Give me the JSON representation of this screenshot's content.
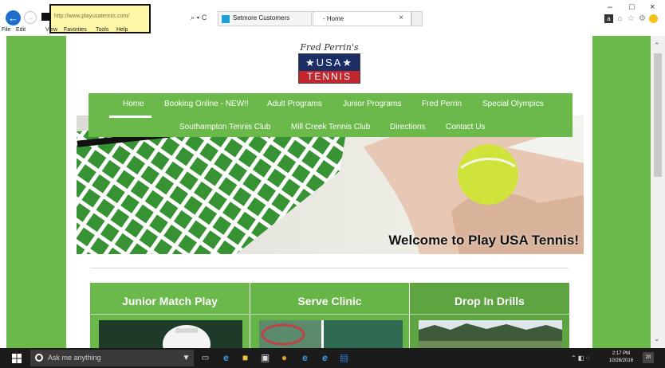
{
  "browser": {
    "address_url": "http://www.playusatennis.com/",
    "addr_controls": "⌕ ▾ C",
    "tabs": [
      {
        "label": "Setmore Customers"
      },
      {
        "label": "- Home",
        "close": "×"
      }
    ],
    "menu": [
      "File",
      "Edit",
      "View",
      "Favorites",
      "Tools",
      "Help"
    ],
    "window_controls": [
      "–",
      "□",
      "×"
    ],
    "toolbar_icons": [
      "profile-icon",
      "home-icon",
      "star-icon",
      "gear-icon",
      "smiley-icon"
    ]
  },
  "site": {
    "logo": {
      "script": "Fred Perrin's",
      "usa": "★USA★",
      "tennis": "TENNIS"
    },
    "nav": {
      "row1": [
        "Home",
        "Booking Online - NEW!!",
        "Adult Programs",
        "Junior Programs",
        "Fred Perrin",
        "Special Olympics"
      ],
      "row2": [
        "Southampton Tennis Club",
        "Mill Creek Tennis Club",
        "Directions",
        "Contact Us"
      ],
      "active": "Home"
    },
    "hero_text": "Welcome to Play USA Tennis!",
    "cards": [
      {
        "title": "Junior Match Play"
      },
      {
        "title": "Serve Clinic"
      },
      {
        "title": "Drop In Drills"
      }
    ],
    "colors": {
      "accent": "#6ab94a",
      "card_dark": "#5ea541",
      "logo_navy": "#1b2f66",
      "logo_red": "#c3262d"
    }
  },
  "taskbar": {
    "search_placeholder": "Ask me anything",
    "time": "2:17 PM",
    "date": "10/28/2016",
    "notification_count": "20",
    "pinned_icons": [
      "microphone-icon",
      "task-view-icon",
      "edge-icon",
      "file-explorer-icon",
      "store-icon",
      "chrome-icon",
      "edge-icon",
      "ie-icon",
      "outlook-icon"
    ]
  }
}
